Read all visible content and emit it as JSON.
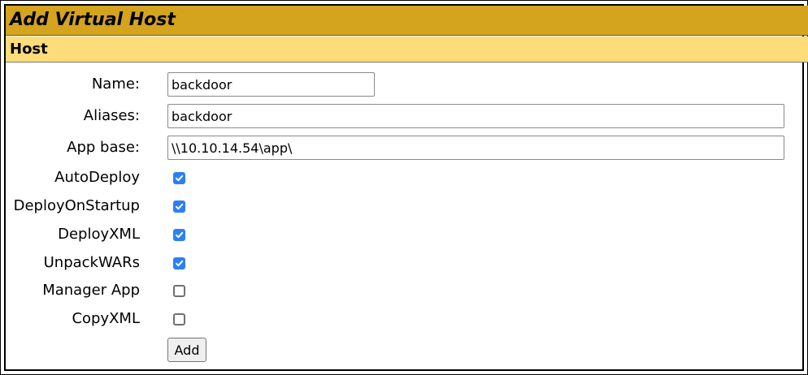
{
  "title": "Add Virtual Host",
  "section": "Host",
  "fields": {
    "name": {
      "label": "Name:",
      "value": "backdoor"
    },
    "aliases": {
      "label": "Aliases:",
      "value": "backdoor"
    },
    "app_base": {
      "label": "App base:",
      "value": "\\\\10.10.14.54\\app\\"
    }
  },
  "options": [
    {
      "label": "AutoDeploy",
      "checked": true
    },
    {
      "label": "DeployOnStartup",
      "checked": true
    },
    {
      "label": "DeployXML",
      "checked": true
    },
    {
      "label": "UnpackWARs",
      "checked": true
    },
    {
      "label": "Manager App",
      "checked": false
    },
    {
      "label": "CopyXML",
      "checked": false
    }
  ],
  "add_label": "Add",
  "colors": {
    "title_bg": "#d4a41f",
    "section_bg": "#ffdc7a",
    "checkbox_accent": "#2d7ff9"
  }
}
